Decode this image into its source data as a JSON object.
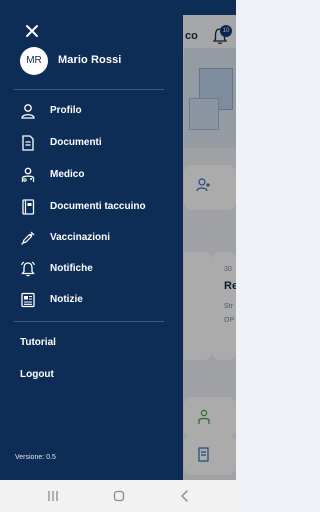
{
  "background": {
    "header_text": "co",
    "notification_count": "10",
    "news": {
      "date": "30",
      "title": "Re",
      "snippet": "Str OP"
    }
  },
  "drawer": {
    "close_icon": "close-icon",
    "avatar_initials": "MR",
    "user_name": "Mario Rossi",
    "menu": [
      {
        "label": "Profilo",
        "icon": "person-icon"
      },
      {
        "label": "Documenti",
        "icon": "document-icon"
      },
      {
        "label": "Medico",
        "icon": "doctor-icon"
      },
      {
        "label": "Documenti taccuino",
        "icon": "notebook-icon"
      },
      {
        "label": "Vaccinazioni",
        "icon": "syringe-icon"
      },
      {
        "label": "Notifiche",
        "icon": "bell-icon"
      },
      {
        "label": "Notizie",
        "icon": "news-icon"
      }
    ],
    "extra": [
      {
        "label": "Tutorial"
      },
      {
        "label": "Logout"
      }
    ],
    "version": "Versione: 0.5"
  },
  "colors": {
    "drawer_bg": "#0d2d57",
    "text": "#ffffff",
    "background": "#eef1f5"
  },
  "navbar": {
    "buttons": [
      "recent-apps-icon",
      "home-icon",
      "back-icon"
    ]
  }
}
